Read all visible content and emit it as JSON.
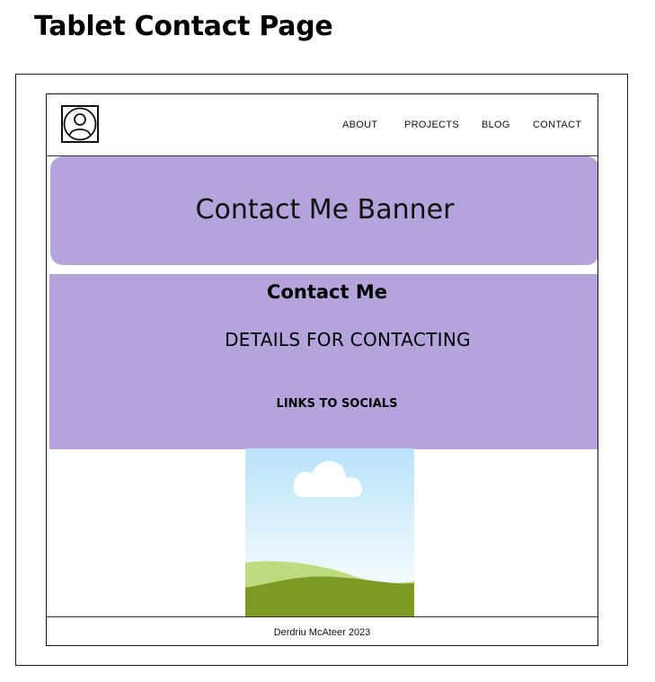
{
  "page": {
    "title": "Tablet Contact Page"
  },
  "header": {
    "logo_icon": "user-avatar-icon",
    "nav": [
      {
        "label": "ABOUT"
      },
      {
        "label": "PROJECTS"
      },
      {
        "label": "BLOG"
      },
      {
        "label": "CONTACT"
      }
    ]
  },
  "banner": {
    "text": "Contact Me Banner",
    "color": "#b5a4db"
  },
  "contact": {
    "heading": "Contact Me",
    "details": "DETAILS FOR CONTACTING",
    "links": "LINKS TO SOCIALS"
  },
  "image": {
    "icon": "landscape-image-icon"
  },
  "footer": {
    "text": "Derdriu McAteer 2023"
  }
}
